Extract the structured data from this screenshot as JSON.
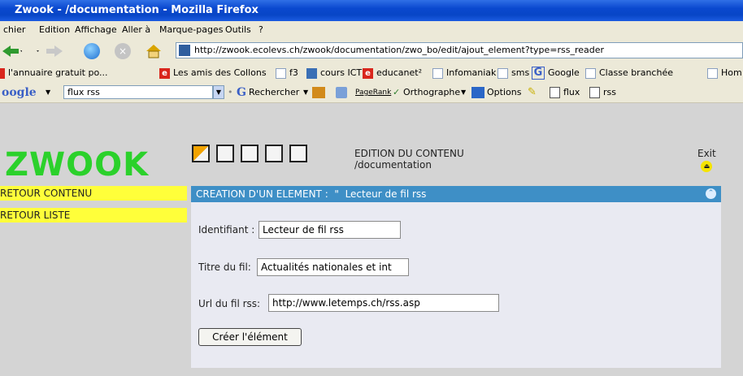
{
  "window": {
    "title": "Zwook - /documentation - Mozilla Firefox"
  },
  "menu": [
    "chier",
    "Edition",
    "Affichage",
    "Aller à",
    "Marque-pages",
    "Outils",
    "?"
  ],
  "nav": {
    "url": "http://zwook.ecolevs.ch/zwook/documentation/zwo_bo/edit/ajout_element?type=rss_reader"
  },
  "bookmarks": [
    {
      "label": "l'annuaire gratuit po...",
      "icon": "page-icon"
    },
    {
      "label": "Les amis des Collons",
      "icon": "red-e-icon"
    },
    {
      "label": "f3",
      "icon": "page-icon"
    },
    {
      "label": "cours ICT",
      "icon": "blue-square-icon"
    },
    {
      "label": "educanet²",
      "icon": "red-e-icon"
    },
    {
      "label": "Infomaniak",
      "icon": "page-icon"
    },
    {
      "label": "sms",
      "icon": "page-icon"
    },
    {
      "label": "Google",
      "icon": "google-g-icon"
    },
    {
      "label": "Classe branchée",
      "icon": "page-icon"
    },
    {
      "label": "Hom",
      "icon": "page-icon"
    }
  ],
  "google_toolbar": {
    "brand": "oogle",
    "search_value": "flux rss",
    "search_btn": "Rechercher",
    "pagerank": "PageRank",
    "spell": "Orthographe",
    "options": "Options",
    "flux": "flux",
    "rss": "rss"
  },
  "app": {
    "logo": "ZWOOK",
    "edition_title": "EDITION DU CONTENU",
    "edition_path": "/documentation",
    "exit": "Exit"
  },
  "sidebar": [
    "RETOUR CONTENU",
    "RETOUR LISTE"
  ],
  "panel": {
    "header": "CREATION D'UN ELEMENT :",
    "sep": "\"",
    "subheader": "Lecteur de fil rss",
    "fields": [
      {
        "label": "Identifiant :",
        "value": "Lecteur de fil rss"
      },
      {
        "label": "Titre du fil:",
        "value": "Actualités nationales et int"
      },
      {
        "label": "Url du fil rss:",
        "value": "http://www.letemps.ch/rss.asp"
      }
    ],
    "submit": "Créer l'élément"
  }
}
